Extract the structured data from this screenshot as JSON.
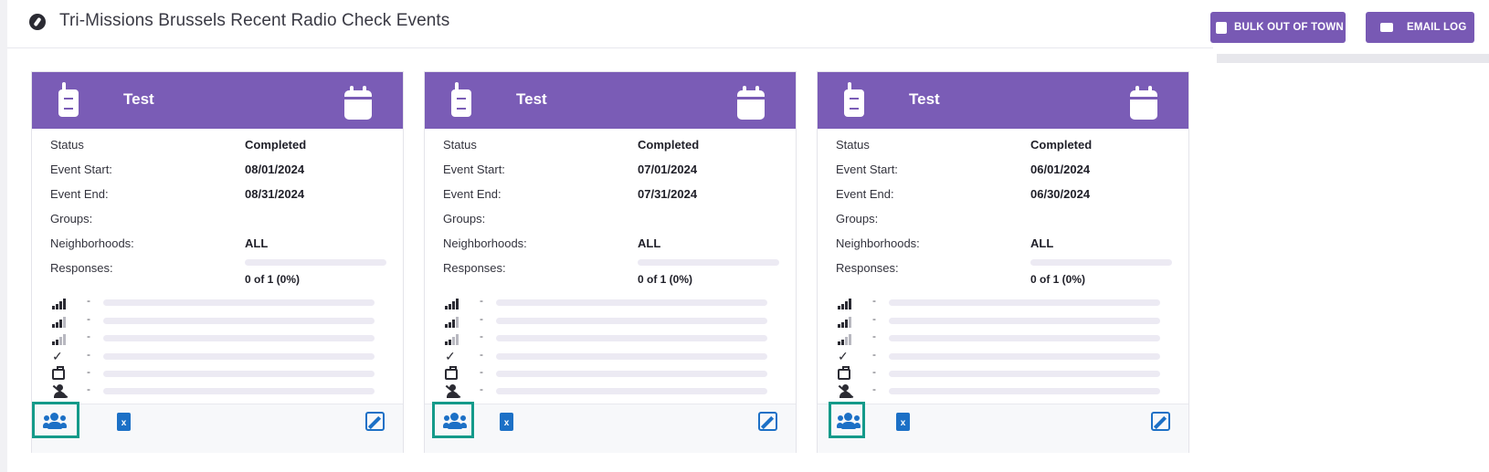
{
  "page": {
    "title": "Tri-Missions Brussels Recent Radio Check Events"
  },
  "toolbar": {
    "bulk_label": "BULK OUT OF TOWN",
    "email_label": "EMAIL LOG"
  },
  "labels": {
    "status": "Status",
    "event_start": "Event Start:",
    "event_end": "Event End:",
    "groups": "Groups:",
    "neighborhoods": "Neighborhoods:",
    "responses": "Responses:",
    "dash": "-",
    "excel_letter": "x"
  },
  "cards": [
    {
      "title": "Test",
      "status": "Completed",
      "event_start": "08/01/2024",
      "event_end": "08/31/2024",
      "groups": "",
      "neighborhoods": "ALL",
      "responses_text": "0 of 1  (0%)",
      "responses_fraction": 0
    },
    {
      "title": "Test",
      "status": "Completed",
      "event_start": "07/01/2024",
      "event_end": "07/31/2024",
      "groups": "",
      "neighborhoods": "ALL",
      "responses_text": "0 of 1  (0%)",
      "responses_fraction": 0
    },
    {
      "title": "Test",
      "status": "Completed",
      "event_start": "06/01/2024",
      "event_end": "06/30/2024",
      "groups": "",
      "neighborhoods": "ALL",
      "responses_text": "0 of 1  (0%)",
      "responses_fraction": 0
    }
  ],
  "stat_icons": [
    "signal-strong-icon",
    "signal-medium-icon",
    "signal-weak-icon",
    "double-check-icon",
    "suitcase-icon",
    "person-slash-icon"
  ],
  "colors": {
    "accent": "#7a5cb6",
    "action_blue": "#1c70c6",
    "highlight_teal": "#149a8a"
  }
}
